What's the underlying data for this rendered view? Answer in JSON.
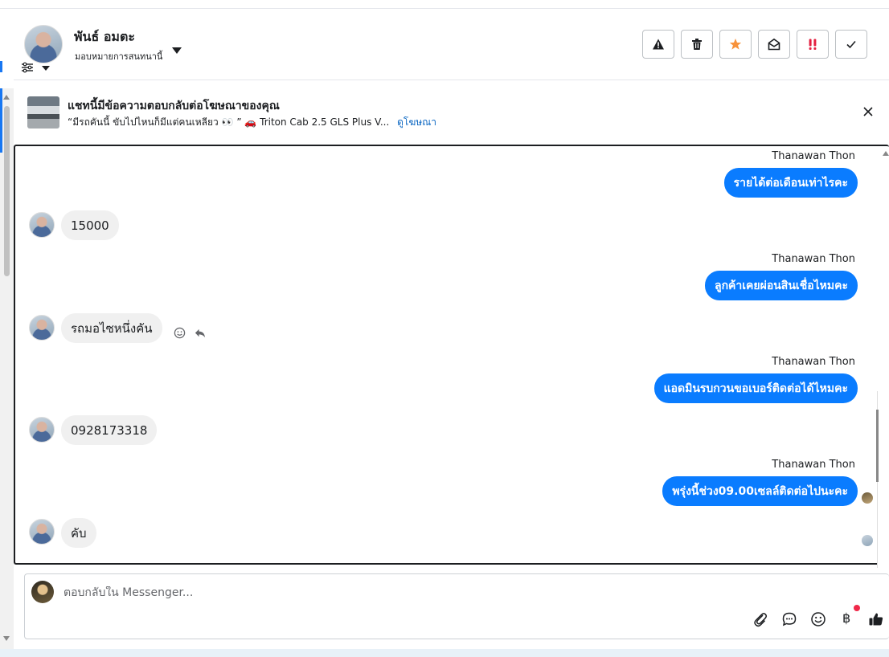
{
  "header": {
    "contact_name": "พันธ์ อมตะ",
    "assign_label": "มอบหมายการสนทนานี้",
    "actions": [
      {
        "name": "spam",
        "icon": "warning-icon"
      },
      {
        "name": "delete",
        "icon": "trash-icon"
      },
      {
        "name": "star",
        "icon": "star-icon",
        "color": "#f7923b"
      },
      {
        "name": "mark-unread",
        "icon": "envelope-open-icon"
      },
      {
        "name": "priority",
        "icon": "exclamation-icon",
        "color": "#e41e3f"
      },
      {
        "name": "done",
        "icon": "check-icon"
      }
    ]
  },
  "ad_banner": {
    "title": "แชทนี้มีข้อความตอบกลับต่อโฆษณาของคุณ",
    "text": "“มีรถคันนี้ ขับไปไหนก็มีแต่คนเหลียว 👀 ” 🚗 Triton Cab 2.5 GLS Plus V...",
    "link": "ดูโฆษณา"
  },
  "messages": [
    {
      "direction": "out",
      "sender": "Thanawan Thon",
      "text": "รายได้ต่อเดือนเท่าไรคะ"
    },
    {
      "direction": "in",
      "text": "15000"
    },
    {
      "direction": "out",
      "sender": "Thanawan Thon",
      "text": "ลูกค้าเคยผ่อนสินเชื่อไหมคะ"
    },
    {
      "direction": "in",
      "text": "รถมอไซหนึ่งคัน"
    },
    {
      "direction": "out",
      "sender": "Thanawan Thon",
      "text": "แอดมินรบกวนขอเบอร์ติดต่อได้ไหมคะ"
    },
    {
      "direction": "in",
      "text": "0928173318"
    },
    {
      "direction": "out",
      "sender": "Thanawan Thon",
      "text": "พรุ่งนี้ช่วง09.00เซลล์ติดต่อไปนะคะ"
    },
    {
      "direction": "in",
      "text": "คับ"
    }
  ],
  "composer": {
    "placeholder": "ตอบกลับใน Messenger...",
    "tools": [
      "paperclip-icon",
      "chat-bubble-icon",
      "smiley-icon",
      "baht-icon",
      "thumbs-up-icon"
    ]
  },
  "colors": {
    "outgoing_bubble": "#0a7cff",
    "incoming_bubble": "#f0f0f0",
    "link": "#0a66c2"
  }
}
